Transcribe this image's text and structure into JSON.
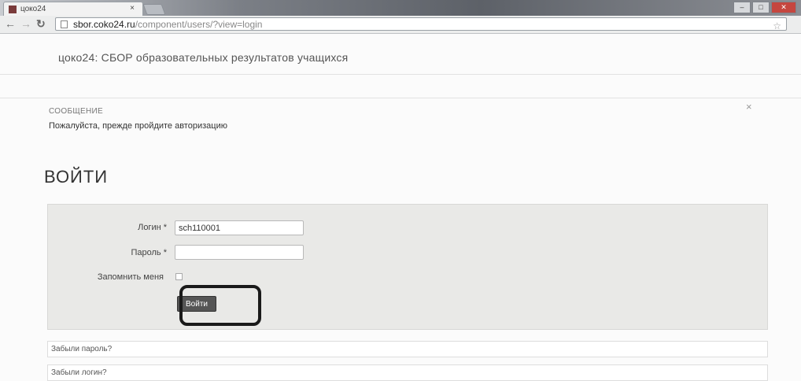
{
  "browser": {
    "tab_title": "цоко24",
    "tab_close": "×",
    "url_host": "sbor.coko24.ru",
    "url_path": "/component/users/?view=login",
    "win_min": "–",
    "win_max": "□",
    "win_close": "✕"
  },
  "site": {
    "title": "цоко24: СБОР образовательных результатов учащихся"
  },
  "message": {
    "heading": "СООБЩЕНИЕ",
    "text": "Пожалуйста, прежде пройдите авторизацию",
    "close": "×"
  },
  "login": {
    "heading": "ВОЙТИ",
    "username_label": "Логин *",
    "username_value": "sch110001",
    "password_label": "Пароль *",
    "password_value": "",
    "remember_label": "Запомнить меня",
    "submit_label": "Войти"
  },
  "links": {
    "forgot_password": "Забыли пароль?",
    "forgot_login": "Забыли логин?"
  }
}
